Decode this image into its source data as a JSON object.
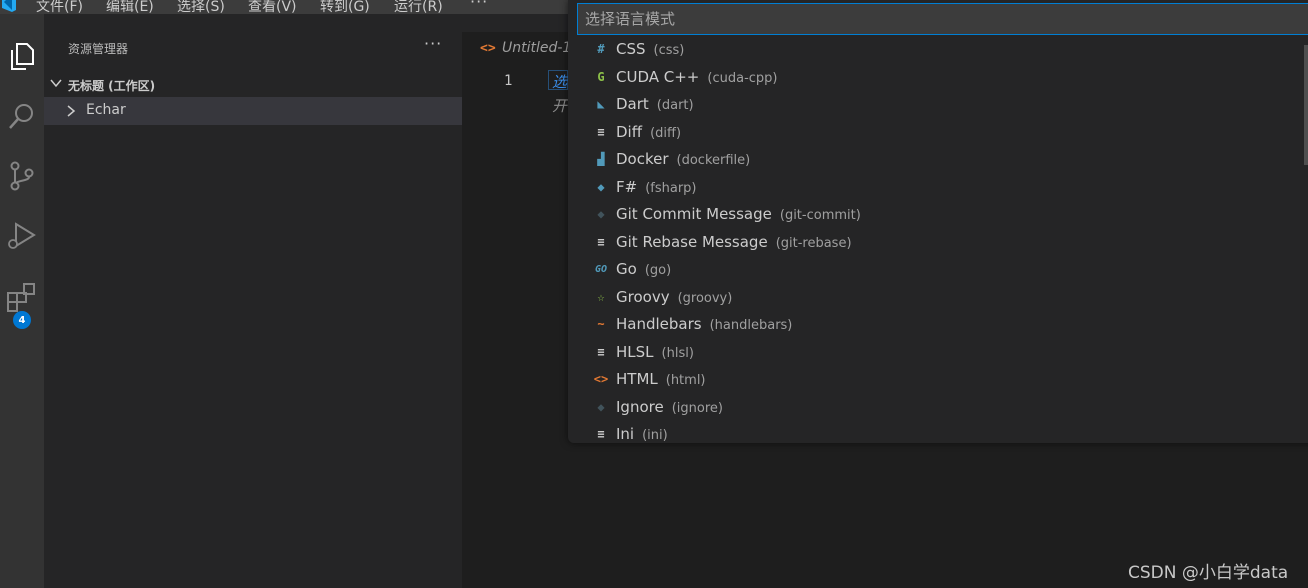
{
  "menubar": {
    "items": [
      "文件(F)",
      "编辑(E)",
      "选择(S)",
      "查看(V)",
      "转到(G)",
      "运行(R)"
    ],
    "more": "···"
  },
  "activitybar": {
    "icons": [
      "explorer-icon",
      "search-icon",
      "source-control-icon",
      "run-debug-icon",
      "extensions-icon"
    ],
    "extensions_badge": "4"
  },
  "sidebar": {
    "title": "资源管理器",
    "more": "···",
    "workspace_title": "无标题 (工作区)",
    "folder": "Echar"
  },
  "editor": {
    "tab_title": "Untitled-1",
    "tab_icon": "<>",
    "line_number": "1",
    "hint_line1": "选",
    "hint_line2": "开"
  },
  "quickpick": {
    "placeholder": "选择语言模式",
    "items": [
      {
        "label": "CSS",
        "id": "(css)",
        "icon": "#",
        "color": "#519aba"
      },
      {
        "label": "CUDA C++",
        "id": "(cuda-cpp)",
        "icon": "G",
        "color": "#8dc149"
      },
      {
        "label": "Dart",
        "id": "(dart)",
        "icon": "◣",
        "color": "#519aba"
      },
      {
        "label": "Diff",
        "id": "(diff)",
        "icon": "≡",
        "color": "#cccccc"
      },
      {
        "label": "Docker",
        "id": "(dockerfile)",
        "icon": "▟",
        "color": "#519aba"
      },
      {
        "label": "F#",
        "id": "(fsharp)",
        "icon": "◆",
        "color": "#519aba"
      },
      {
        "label": "Git Commit Message",
        "id": "(git-commit)",
        "icon": "◆",
        "color": "#41535b"
      },
      {
        "label": "Git Rebase Message",
        "id": "(git-rebase)",
        "icon": "≡",
        "color": "#cccccc"
      },
      {
        "label": "Go",
        "id": "(go)",
        "icon": "GO",
        "color": "#519aba"
      },
      {
        "label": "Groovy",
        "id": "(groovy)",
        "icon": "☆",
        "color": "#8dc149"
      },
      {
        "label": "Handlebars",
        "id": "(handlebars)",
        "icon": "~",
        "color": "#e37933"
      },
      {
        "label": "HLSL",
        "id": "(hlsl)",
        "icon": "≡",
        "color": "#cccccc"
      },
      {
        "label": "HTML",
        "id": "(html)",
        "icon": "<>",
        "color": "#e37933"
      },
      {
        "label": "Ignore",
        "id": "(ignore)",
        "icon": "◆",
        "color": "#41535b"
      },
      {
        "label": "Ini",
        "id": "(ini)",
        "icon": "≡",
        "color": "#cccccc"
      }
    ]
  },
  "watermark": "CSDN @小白学data",
  "colors": {
    "accent": "#007fd4",
    "badge": "#0078d4",
    "sidebar_bg": "#252526",
    "editor_bg": "#1e1e1e",
    "activitybar_bg": "#333333"
  }
}
